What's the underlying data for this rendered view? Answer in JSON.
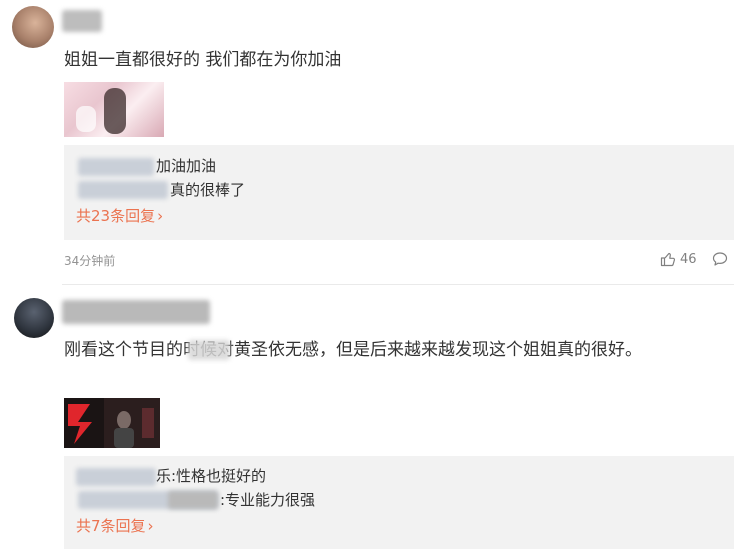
{
  "comments": [
    {
      "text": "姐姐一直都很好的 我们都在为你加油",
      "replies": [
        {
          "text": "加油加油"
        },
        {
          "text": "真的很棒了"
        }
      ],
      "more_replies": "共23条回复",
      "more_arrow": "›",
      "time": "34分钟前",
      "likes": "46"
    },
    {
      "text": "刚看这个节目的时候对黄圣依无感，但是后来越来越发现这个姐姐真的很好。",
      "replies": [
        {
          "text": "乐:性格也挺好的"
        },
        {
          "text": ":专业能力很强"
        }
      ],
      "more_replies": "共7条回复",
      "more_arrow": "›"
    }
  ],
  "colors": {
    "more_link": "#eb7350",
    "reply_bg": "#f2f2f2",
    "meta": "#939393"
  },
  "icons": [
    "thumbs-up-icon",
    "comment-icon"
  ]
}
